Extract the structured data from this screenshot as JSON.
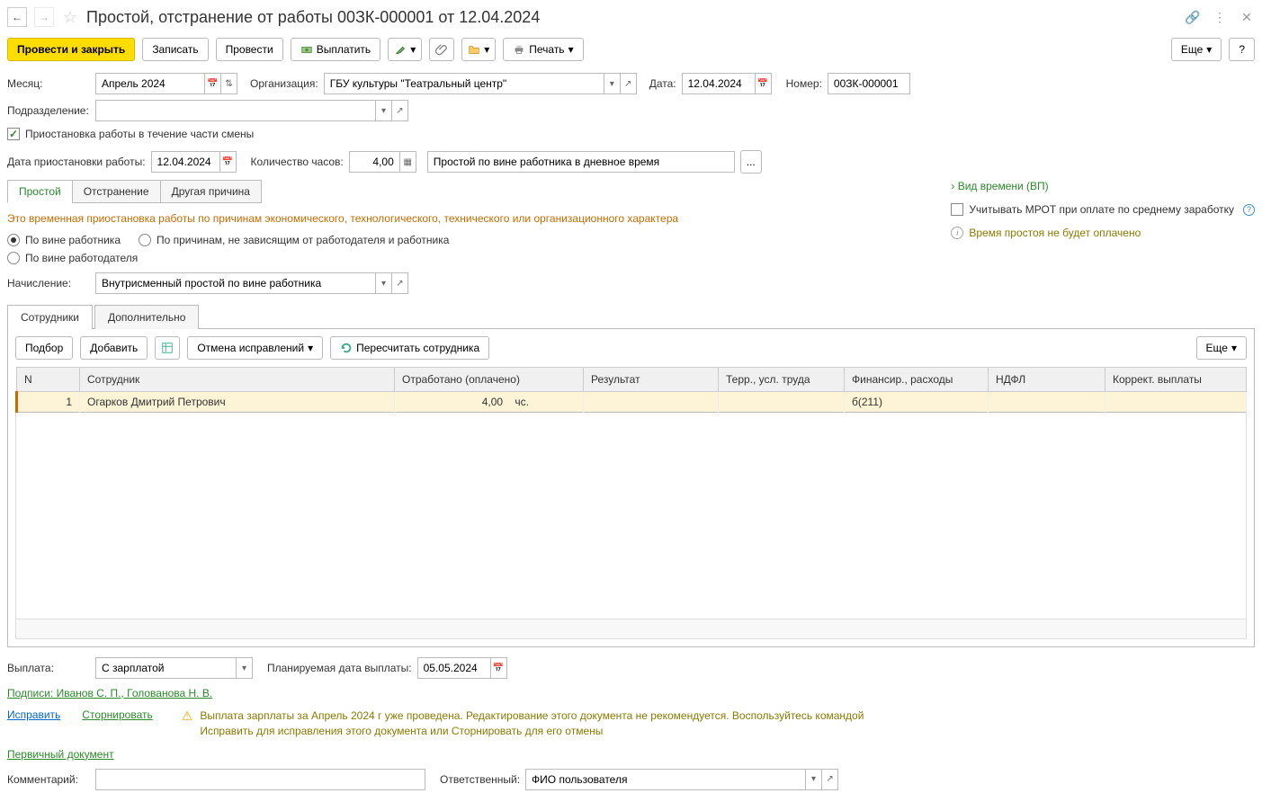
{
  "header": {
    "title": "Простой, отстранение от работы 00ЗК-000001 от 12.04.2024"
  },
  "toolbar": {
    "post_and_close": "Провести и закрыть",
    "save": "Записать",
    "post": "Провести",
    "pay": "Выплатить",
    "print": "Печать",
    "more": "Еще",
    "help": "?"
  },
  "fields": {
    "month_label": "Месяц:",
    "month_value": "Апрель 2024",
    "org_label": "Организация:",
    "org_value": "ГБУ культуры \"Театральный центр\"",
    "date_label": "Дата:",
    "date_value": "12.04.2024",
    "number_label": "Номер:",
    "number_value": "00ЗК-000001",
    "subdivision_label": "Подразделение:",
    "subdivision_value": "",
    "pause_checkbox": "Приостановка работы в течение части смены",
    "pause_date_label": "Дата приостановки работы:",
    "pause_date_value": "12.04.2024",
    "hours_label": "Количество часов:",
    "hours_value": "4,00",
    "reason_value": "Простой по вине работника в дневное время"
  },
  "cause_tabs": {
    "idle": "Простой",
    "suspension": "Отстранение",
    "other": "Другая причина"
  },
  "cause_desc": "Это временная приостановка работы по причинам экономического, технологического, технического или организационного характера",
  "radios": {
    "employee_fault": "По вине работника",
    "no_fault": "По причинам, не зависящим от работодателя и работника",
    "employer_fault": "По вине работодателя"
  },
  "accrual": {
    "label": "Начисление:",
    "value": "Внутрисменный простой по вине работника"
  },
  "right_panel": {
    "time_type": "Вид времени (ВП)",
    "mrot": "Учитывать МРОТ при оплате по среднему заработку",
    "info": "Время простоя не будет оплачено"
  },
  "main_tabs": {
    "employees": "Сотрудники",
    "additional": "Дополнительно"
  },
  "emp_toolbar": {
    "select": "Подбор",
    "add": "Добавить",
    "cancel_fixes": "Отмена исправлений",
    "recalc": "Пересчитать сотрудника",
    "more": "Еще"
  },
  "table": {
    "headers": {
      "n": "N",
      "employee": "Сотрудник",
      "worked": "Отработано (оплачено)",
      "result": "Результат",
      "territory": "Терр., усл. труда",
      "financing": "Финансир., расходы",
      "ndfl": "НДФЛ",
      "correction": "Коррект. выплаты"
    },
    "rows": [
      {
        "n": "1",
        "employee": "Огарков Дмитрий Петрович",
        "worked_hours": "4,00",
        "worked_unit": "чс.",
        "result": "",
        "territory": "",
        "financing": "б(211)",
        "ndfl": "",
        "correction": ""
      }
    ]
  },
  "bottom": {
    "payment_label": "Выплата:",
    "payment_value": "С зарплатой",
    "planned_date_label": "Планируемая дата выплаты:",
    "planned_date_value": "05.05.2024",
    "signatures": "Подписи: Иванов С. П., Голованова Н. В.",
    "fix_link": "Исправить",
    "storno_link": "Сторнировать",
    "warning": "Выплата зарплаты за Апрель 2024 г уже проведена. Редактирование этого документа не рекомендуется. Воспользуйтесь командой Исправить для исправления этого документа или Сторнировать для его отмены",
    "primary_doc": "Первичный документ",
    "comment_label": "Комментарий:",
    "comment_value": "",
    "responsible_label": "Ответственный:",
    "responsible_value": "ФИО пользователя"
  }
}
